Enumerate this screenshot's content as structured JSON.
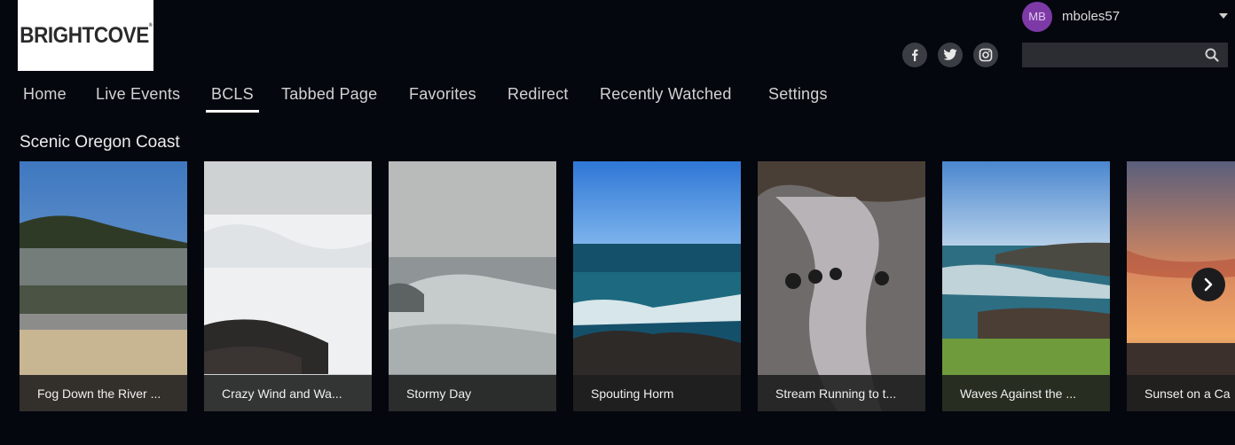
{
  "brand": {
    "logo_text": "BRIGHTCOVE",
    "trademark": "®"
  },
  "user": {
    "initials": "MB",
    "username": "mboles57"
  },
  "social": [
    {
      "name": "facebook",
      "glyph": "f"
    },
    {
      "name": "twitter"
    },
    {
      "name": "instagram"
    }
  ],
  "search": {
    "placeholder": "",
    "value": ""
  },
  "nav": {
    "items": [
      {
        "label": "Home",
        "active": false
      },
      {
        "label": "Live Events",
        "active": false
      },
      {
        "label": "BCLS",
        "active": true
      },
      {
        "label": "Tabbed Page",
        "active": false
      },
      {
        "label": "Favorites",
        "active": false
      },
      {
        "label": "Redirect",
        "active": false
      },
      {
        "label": "Recently Watched",
        "active": false
      },
      {
        "label": "Settings",
        "active": false
      }
    ]
  },
  "section": {
    "title": "Scenic Oregon Coast",
    "videos": [
      {
        "title": "Fog Down the River ..."
      },
      {
        "title": "Crazy Wind and Wa..."
      },
      {
        "title": "Stormy Day"
      },
      {
        "title": "Spouting Horm"
      },
      {
        "title": "Stream Running to t..."
      },
      {
        "title": "Waves Against the ..."
      },
      {
        "title": "Sunset on a Ca"
      }
    ]
  },
  "colors": {
    "background": "#05070f",
    "avatar": "#7d3aa6",
    "caption_bg": "#1e1e1e"
  }
}
